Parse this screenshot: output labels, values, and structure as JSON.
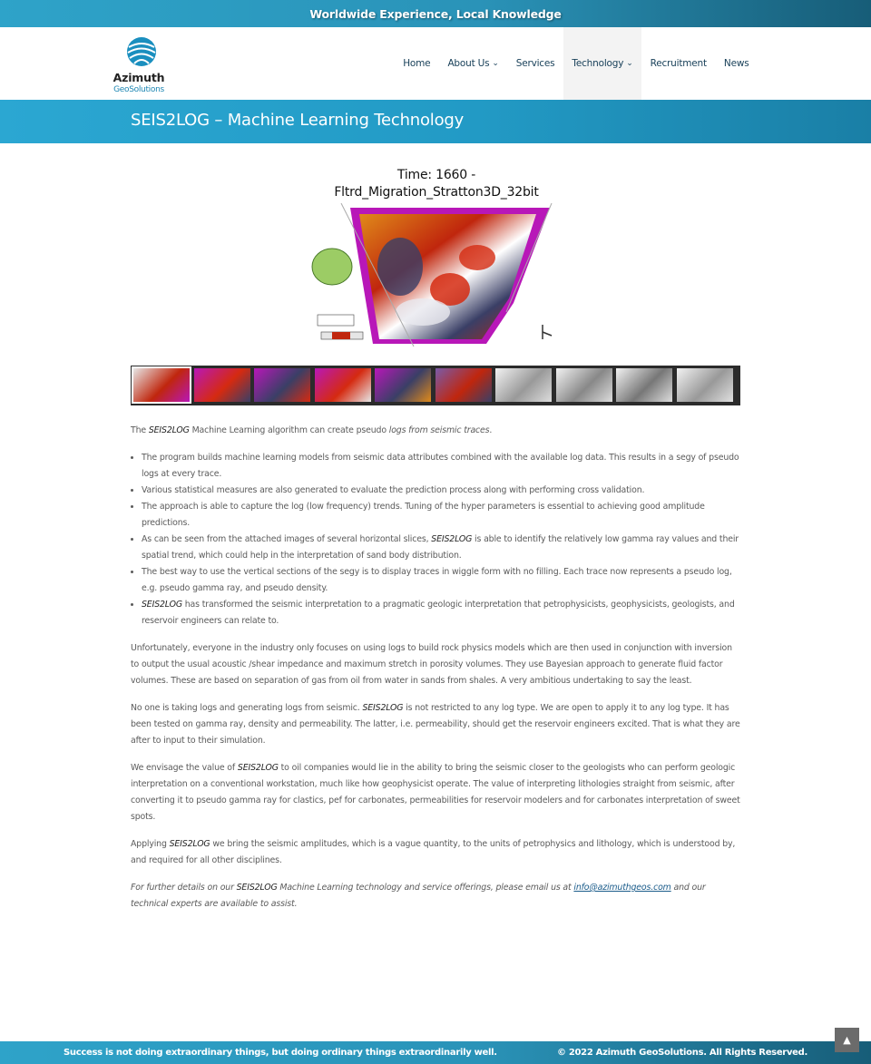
{
  "topbar": {
    "tagline": "Worldwide Experience, Local Knowledge"
  },
  "logo": {
    "name": "Azimuth",
    "sub": "GeoSolutions"
  },
  "nav": {
    "items": [
      {
        "label": "Home",
        "has_dropdown": false,
        "active": false
      },
      {
        "label": "About Us",
        "has_dropdown": true,
        "active": false
      },
      {
        "label": "Services",
        "has_dropdown": false,
        "active": false
      },
      {
        "label": "Technology",
        "has_dropdown": true,
        "active": true
      },
      {
        "label": "Recruitment",
        "has_dropdown": false,
        "active": false
      },
      {
        "label": "News",
        "has_dropdown": false,
        "active": false
      }
    ]
  },
  "page": {
    "title": "SEIS2LOG – Machine Learning Technology"
  },
  "figure": {
    "title_line1": "Time: 1660 -",
    "title_line2": "Fltrd_Migration_Stratton3D_32bit"
  },
  "carousel": {
    "thumb_count": 10,
    "selected_index": 0
  },
  "content": {
    "intro": {
      "pre": "The ",
      "brand": "SEIS2LOG",
      "mid": " Machine Learning algorithm can create pseudo ",
      "em": "logs from seismic traces",
      "post": "."
    },
    "bullets": {
      "b1": "The program builds machine learning models from seismic data attributes combined with the available log data. This results in a segy of pseudo logs at every trace.",
      "b2": "Various statistical measures are also generated to evaluate the prediction process along with performing cross validation.",
      "b3": "The approach is able to capture the log (low frequency) trends. Tuning of the hyper parameters is essential to achieving good amplitude predictions.",
      "b4_pre": "As can be seen from the attached images of several horizontal slices, ",
      "b4_brand": "SEIS2LOG",
      "b4_post": " is able to identify the relatively low gamma ray values and their spatial trend, which could help in the interpretation of sand body distribution.",
      "b5": "The best way to use the vertical sections of the segy is to display traces in wiggle form with no filling. Each trace now represents a pseudo log, e.g. pseudo gamma ray, and pseudo density.",
      "b6_brand": "SEIS2LOG",
      "b6_post": " has transformed the seismic interpretation to a pragmatic geologic interpretation that petrophysicists, geophysicists, geologists, and reservoir engineers can relate to."
    },
    "p1": "Unfortunately, everyone in the industry only focuses on using logs to build rock physics models which are then used in conjunction with inversion to output the usual acoustic /shear impedance and maximum stretch in porosity volumes. They use Bayesian approach to generate fluid factor volumes. These are based on separation of gas from oil from water in sands from shales. A very ambitious undertaking to say the least.",
    "p2": {
      "pre": "No one is taking logs and generating logs from seismic. ",
      "brand": "SEIS2LOG",
      "post": " is not restricted to any log type. We are open to apply it to any log type. It has been tested on gamma ray, density and permeability. The latter, i.e. permeability, should get the reservoir engineers excited. That is what they are after to input to their simulation."
    },
    "p3": {
      "pre": "We envisage the value of ",
      "brand": "SEIS2LOG",
      "post": " to oil companies would lie in the ability to bring the seismic closer to the geologists who can perform geologic interpretation on a conventional workstation, much like how geophysicist operate. The value of interpreting lithologies straight from seismic, after converting it to pseudo gamma ray for clastics, pef for carbonates, permeabilities for reservoir modelers and for carbonates interpretation of sweet spots."
    },
    "p4": {
      "pre": "Applying ",
      "brand": "SEIS2LOG",
      "post": " we bring the seismic amplitudes, which is a vague quantity, to the units of petrophysics and lithology, which is understood by, and required for all other disciplines."
    },
    "p5": {
      "pre": "For further details on our ",
      "brand": "SEIS2LOG",
      "mid": " Machine Learning technology and service offerings, please email us at ",
      "email": "info@azimuthgeos.com",
      "post": " and our technical experts are available to assist."
    }
  },
  "footer": {
    "quote": "Success is not doing extraordinary things, but doing ordinary things extraordinarily well.",
    "copyright": "© 2022 Azimuth GeoSolutions. All Rights Reserved."
  },
  "colors": {
    "brand_blue": "#2ba7d2",
    "nav_text": "#173f58",
    "seismic_magenta": "#b817b8"
  }
}
